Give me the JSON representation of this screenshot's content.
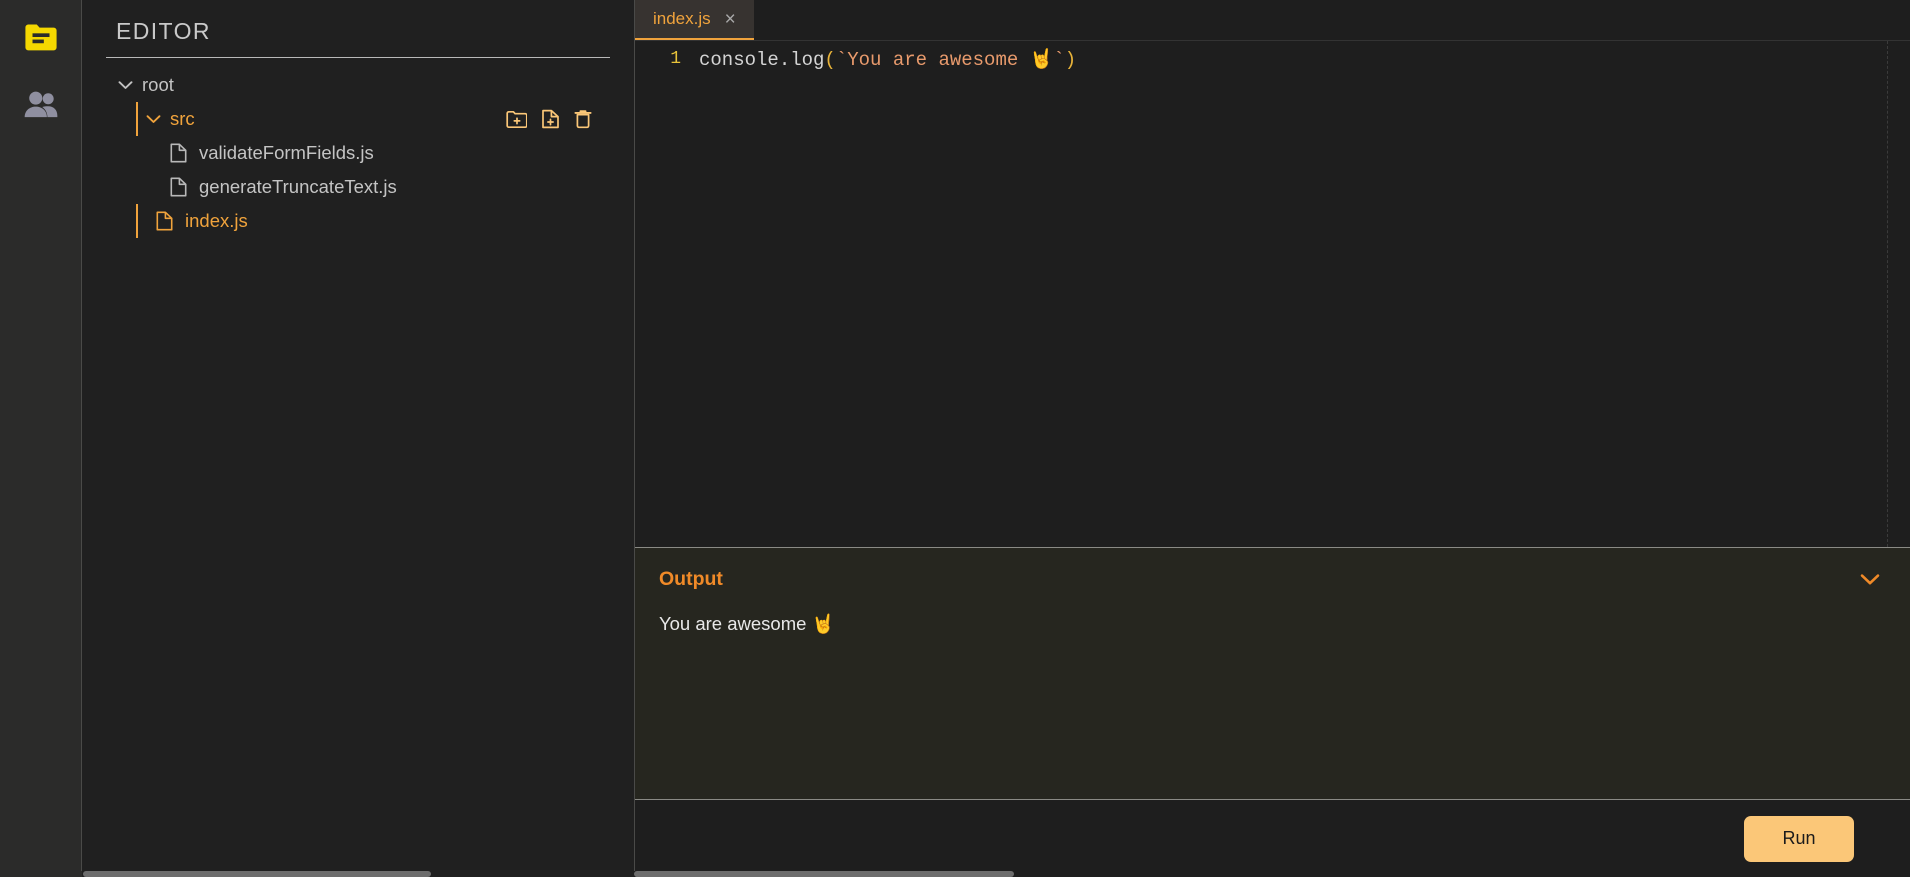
{
  "activity_bar": {
    "items": [
      {
        "icon": "folder-icon",
        "active": true
      },
      {
        "icon": "users-icon",
        "active": false
      }
    ]
  },
  "explorer": {
    "title": "EDITOR",
    "tree": [
      {
        "label": "root",
        "type": "folder",
        "depth": 0,
        "expanded": true,
        "selected": false
      },
      {
        "label": "src",
        "type": "folder",
        "depth": 1,
        "expanded": true,
        "selected": true
      },
      {
        "label": "validateFormFields.js",
        "type": "file",
        "depth": 2,
        "selected": false
      },
      {
        "label": "generateTruncateText.js",
        "type": "file",
        "depth": 2,
        "selected": false
      },
      {
        "label": "index.js",
        "type": "file",
        "depth": 1,
        "selected": true
      }
    ],
    "actions": [
      {
        "name": "new-folder-icon",
        "title": "New Folder"
      },
      {
        "name": "new-file-icon",
        "title": "New File"
      },
      {
        "name": "delete-icon",
        "title": "Delete"
      }
    ]
  },
  "editor": {
    "tabs": [
      {
        "label": "index.js",
        "close": "×",
        "active": true
      }
    ],
    "line_number": "1",
    "code": {
      "fn": "console.log",
      "open_paren": "(",
      "string": "`You are awesome 🤘`",
      "close_paren": ")"
    }
  },
  "output": {
    "title": "Output",
    "text": "You are awesome 🤘",
    "collapse_icon": "chevron-down-icon"
  },
  "footer": {
    "run_label": "Run"
  },
  "colors": {
    "accent": "#f0a33c",
    "run_button": "#fbc778",
    "output_title": "#f08a28",
    "folder_active": "#f5d800",
    "string_token": "#e89a6c",
    "line_number": "#e8c33a"
  }
}
